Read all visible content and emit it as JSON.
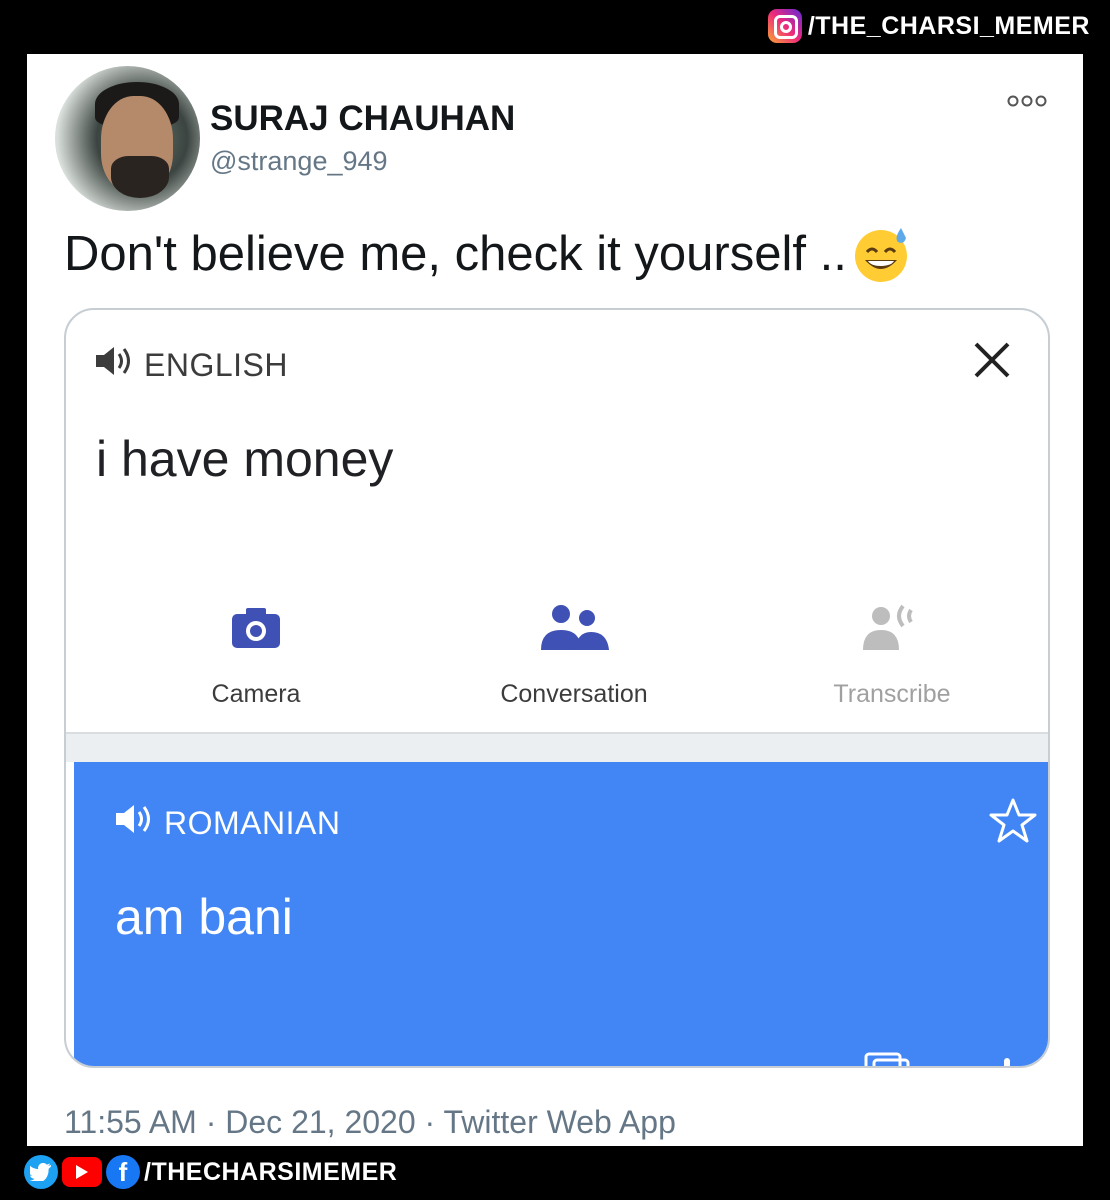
{
  "watermark_top": {
    "icon": "instagram-icon",
    "text": "/THE_CHARSI_MEMER"
  },
  "tweet": {
    "author_name": "SURAJ CHAUHAN",
    "author_handle": "@strange_949",
    "more_icon": "more-options-icon",
    "text": "Don't believe me, check it yourself ..",
    "emoji": "grinning-face-with-sweat",
    "timestamp": "11:55 AM · Dec 21, 2020 · Twitter Web App"
  },
  "translate": {
    "source_language": "ENGLISH",
    "source_text": "i have money",
    "tools": [
      {
        "label": "Camera",
        "icon": "camera-icon",
        "enabled": true
      },
      {
        "label": "Conversation",
        "icon": "conversation-icon",
        "enabled": true
      },
      {
        "label": "Transcribe",
        "icon": "transcribe-icon",
        "enabled": false
      }
    ],
    "target_language": "ROMANIAN",
    "target_text": "am bani",
    "colors": {
      "accent_blue": "#4285f4",
      "icon_blue": "#3f51b5",
      "disabled_grey": "#bdbdbd"
    }
  },
  "watermark_bottom": {
    "icons": [
      "twitter-icon",
      "youtube-icon",
      "facebook-icon"
    ],
    "text": "/THECHARSIMEMER"
  }
}
